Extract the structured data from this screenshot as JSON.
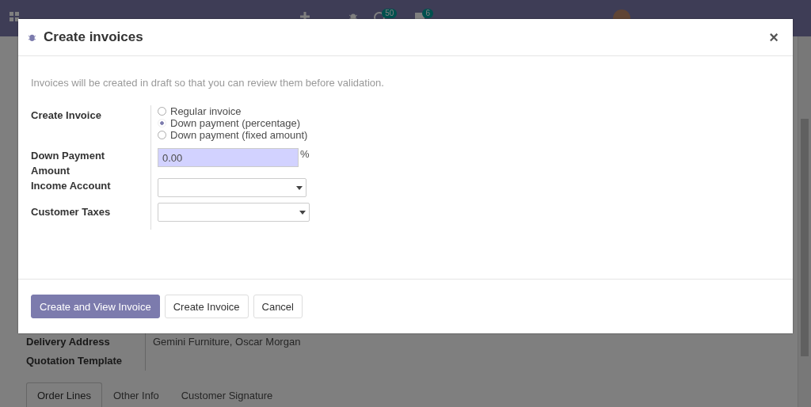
{
  "navbar": {
    "activity_count": "50",
    "message_count": "6"
  },
  "background_form": {
    "fields": [
      {
        "label": "Delivery Address",
        "value": "Gemini Furniture, Oscar Morgan"
      },
      {
        "label": "Quotation Template"
      }
    ],
    "tabs": [
      {
        "label": "Order Lines",
        "selected": true
      },
      {
        "label": "Other Info",
        "selected": false
      },
      {
        "label": "Customer Signature",
        "selected": false
      }
    ]
  },
  "dialog": {
    "title": "Create invoices",
    "close": "×",
    "note": "Invoices will be created in draft so that you can review them before validation.",
    "create_invoice": {
      "label": "Create Invoice",
      "options": [
        {
          "label": "Regular invoice",
          "selected": false
        },
        {
          "label": "Down payment (percentage)",
          "selected": true
        },
        {
          "label": "Down payment (fixed amount)",
          "selected": false
        }
      ]
    },
    "down_payment": {
      "label": "Down Payment Amount",
      "value": "0.00",
      "unit": "%"
    },
    "income_account": {
      "label": "Income Account"
    },
    "customer_taxes": {
      "label": "Customer Taxes"
    },
    "buttons": [
      {
        "label": "Create and View Invoice",
        "kind": "primary"
      },
      {
        "label": "Create Invoice",
        "kind": "secondary"
      },
      {
        "label": "Cancel",
        "kind": "secondary"
      }
    ]
  }
}
